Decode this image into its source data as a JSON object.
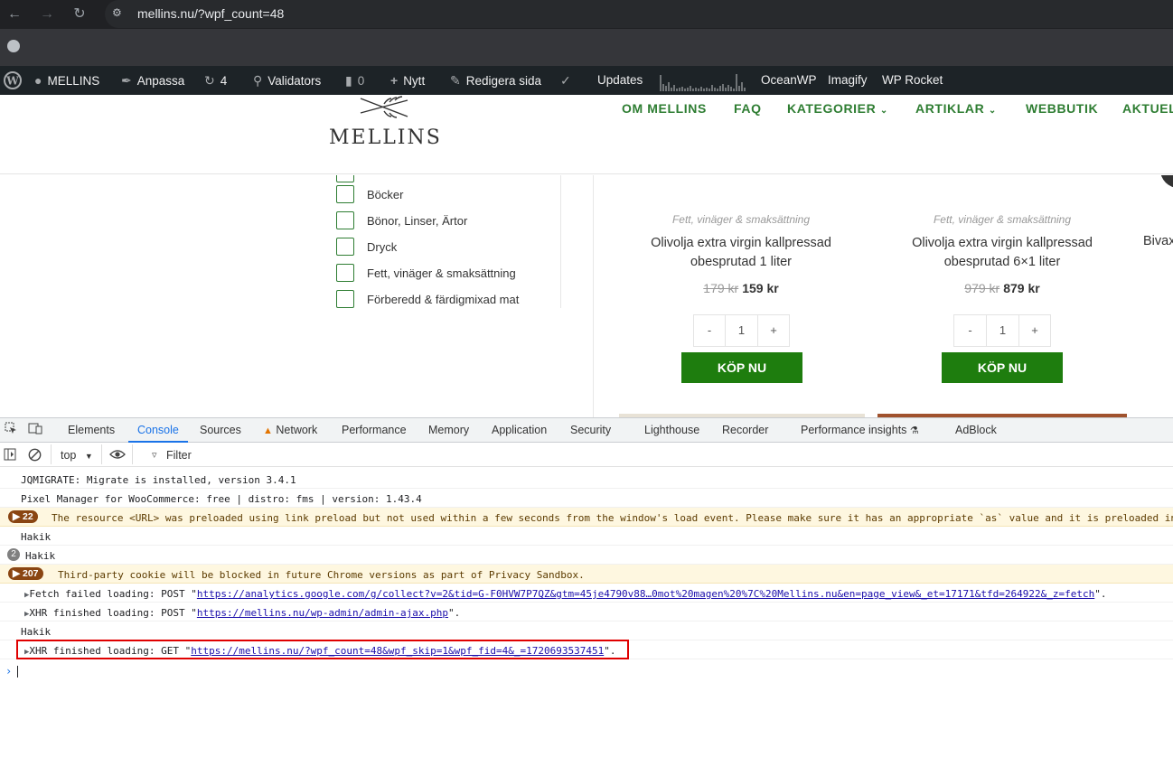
{
  "browser": {
    "url": "mellins.nu/?wpf_count=48"
  },
  "adminbar": {
    "site_name": "MELLINS",
    "customize": "Anpassa",
    "updates_count": "4",
    "validators": "Validators",
    "comments_count": "0",
    "new": "Nytt",
    "edit_page": "Redigera sida",
    "updates": "Updates",
    "oceanwp": "OceanWP",
    "imagify": "Imagify",
    "wp_rocket": "WP Rocket"
  },
  "site": {
    "logo": "MELLINS",
    "menu": [
      "OM MELLINS",
      "FAQ",
      "KATEGORIER",
      "ARTIKLAR",
      "WEBBUTIK",
      "AKTUEL"
    ],
    "categories": [
      "Böcker",
      "Bönor, Linser, Ärtor",
      "Dryck",
      "Fett, vinäger & smaksättning",
      "Förberedd & färdigmixad mat"
    ]
  },
  "products": [
    {
      "category": "Fett, vinäger & smaksättning",
      "title_line1": "Olivolja extra virgin kallpressad",
      "title_line2": "obesprutad 1 liter",
      "old_price": "179 kr",
      "price": "159 kr",
      "qty_minus": "-",
      "qty": "1",
      "qty_plus": "+",
      "buy": "KÖP NU"
    },
    {
      "category": "Fett, vinäger & smaksättning",
      "title_line1": "Olivolja extra virgin kallpressad",
      "title_line2": "obesprutad 6×1 liter",
      "old_price": "979 kr",
      "price": "879 kr",
      "qty_minus": "-",
      "qty": "1",
      "qty_plus": "+",
      "buy": "KÖP NU"
    }
  ],
  "product_partial": "Bivax",
  "devtools": {
    "tabs": [
      "Elements",
      "Console",
      "Sources",
      "Network",
      "Performance",
      "Memory",
      "Application",
      "Security",
      "Lighthouse",
      "Recorder",
      "Performance insights",
      "AdBlock"
    ],
    "active_tab": "Console",
    "context": "top",
    "filter_placeholder": "Filter"
  },
  "console": {
    "l1": "JQMIGRATE: Migrate is installed, version 3.4.1",
    "l2": "Pixel Manager for WooCommerce: free | distro: fms | version: 1.43.4",
    "l3_badge": "22",
    "l3": "The resource <URL> was preloaded using link preload but not used within a few seconds from the window's load event. Please make sure it has an appropriate `as` value and it is preloaded in",
    "l4": "Hakik",
    "l5_count": "2",
    "l5": "Hakik",
    "l6_badge": "207",
    "l6": "Third-party cookie will be blocked in future Chrome versions as part of Privacy Sandbox.",
    "l7_pre": "Fetch failed loading: POST \"",
    "l7_link": "https://analytics.google.com/g/collect?v=2&tid=G-F0HVW7P7QZ&gtm=45je4790v88…0mot%20magen%20%7C%20Mellins.nu&en=page_view&_et=17171&tfd=264922&_z=fetch",
    "l7_post": "\".",
    "l8_pre": "XHR finished loading: POST \"",
    "l8_link": "https://mellins.nu/wp-admin/admin-ajax.php",
    "l8_post": "\".",
    "l9": "Hakik",
    "l10_pre": "XHR finished loading: GET \"",
    "l10_link": "https://mellins.nu/?wpf_count=48&wpf_skip=1&wpf_fid=4&_=1720693537451",
    "l10_post": "\"."
  }
}
